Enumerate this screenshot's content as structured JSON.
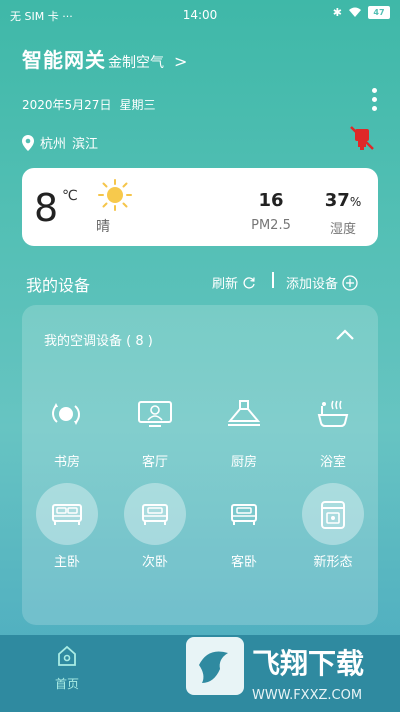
{
  "status_bar": {
    "carrier": "无 SIM 卡 ···",
    "time": "14:00",
    "battery": "47"
  },
  "header": {
    "title": "智能网关",
    "subtitle": "金制空气",
    "chevron": ">"
  },
  "date_row": {
    "date": "2020年5月27日",
    "weekday": "星期三"
  },
  "location": {
    "city": "杭州",
    "district": "滨江"
  },
  "weather": {
    "temperature": "8",
    "unit": "℃",
    "condition": "晴",
    "pm25_value": "16",
    "pm25_label": "PM2.5",
    "humidity_value": "37",
    "humidity_unit": "%",
    "humidity_label": "湿度"
  },
  "devices_section": {
    "title": "我的设备",
    "refresh_label": "刷新",
    "add_label": "添加设备"
  },
  "device_panel": {
    "title": "我的空调设备 ( 8 )",
    "rooms": [
      {
        "label": "书房",
        "icon": "study-room-icon"
      },
      {
        "label": "客厅",
        "icon": "living-room-icon"
      },
      {
        "label": "厨房",
        "icon": "kitchen-icon"
      },
      {
        "label": "浴室",
        "icon": "bathroom-icon"
      },
      {
        "label": "主卧",
        "icon": "master-bedroom-icon"
      },
      {
        "label": "次卧",
        "icon": "second-bedroom-icon"
      },
      {
        "label": "客卧",
        "icon": "guest-bedroom-icon"
      },
      {
        "label": "新形态",
        "icon": "new-form-icon"
      }
    ]
  },
  "bottom_nav": {
    "home_label": "首页"
  },
  "watermark": {
    "brand": "飞翔下载",
    "url": "WWW.FXXZ.COM"
  }
}
